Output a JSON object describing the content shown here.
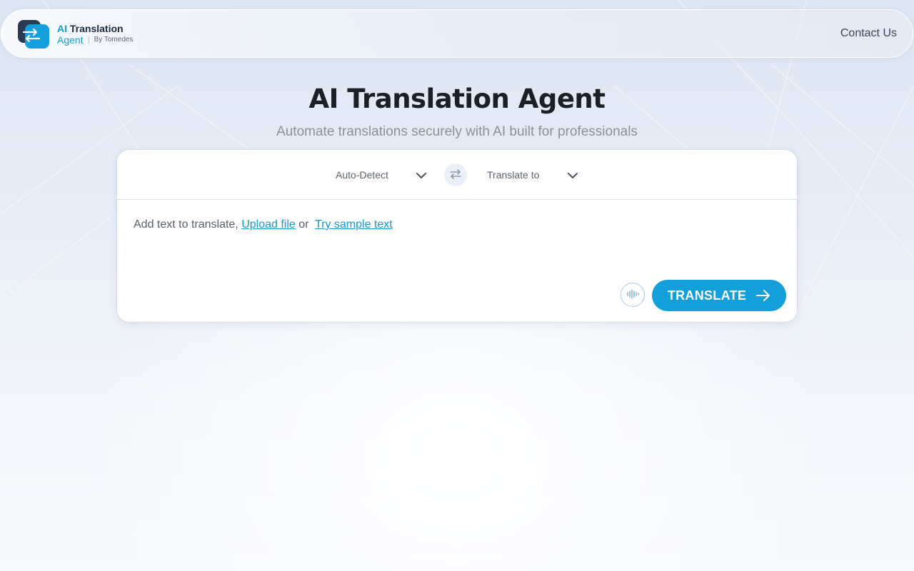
{
  "header": {
    "logo": {
      "line1_ai": "AI",
      "line1_rest": "Translation",
      "line2_agent": "Agent",
      "line2_by": "By Tomedes"
    },
    "contact_label": "Contact Us"
  },
  "hero": {
    "title": "AI Translation Agent",
    "subtitle": "Automate translations securely with AI built for professionals"
  },
  "translator": {
    "source_language": "Auto-Detect",
    "target_language": "Translate to",
    "placeholder_prefix": "Add text to translate,",
    "upload_link": "Upload file",
    "or_text": "or",
    "sample_link": "Try sample text",
    "translate_label": "TRANSLATE"
  },
  "icons": {
    "swap": "swap-arrows-icon",
    "chevron": "chevron-down-icon",
    "voice": "sound-wave-icon",
    "arrow": "arrow-right-icon"
  },
  "colors": {
    "accent": "#129fda",
    "title": "#1b1f26",
    "subtitle": "#8a929c",
    "logo_dark": "#2a3a52"
  }
}
